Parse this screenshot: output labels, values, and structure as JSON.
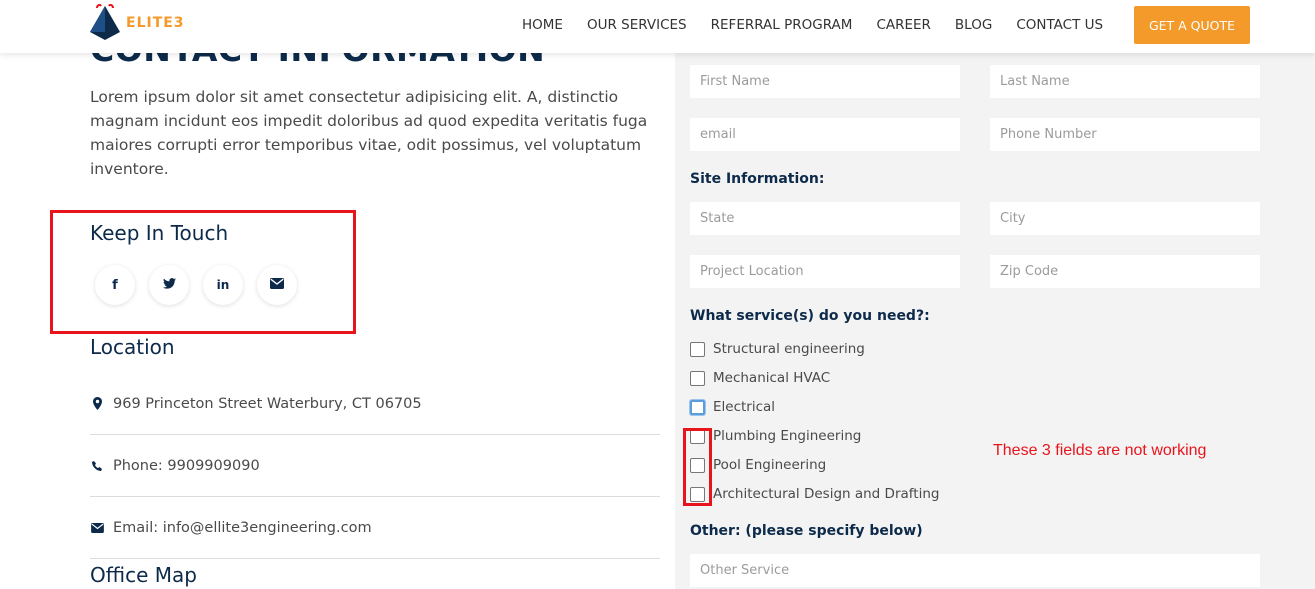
{
  "header": {
    "logo_text": "ELITE3",
    "nav": [
      "HOME",
      "OUR SERVICES",
      "REFERRAL PROGRAM",
      "CAREER",
      "BLOG",
      "CONTACT US"
    ],
    "cta": "GET A QUOTE"
  },
  "contact": {
    "heading": "CONTACT INFORMATION",
    "intro": "Lorem ipsum dolor sit amet consectetur adipisicing elit. A, distinctio magnam incidunt eos impedit doloribus ad quod expedita veritatis fuga maiores corrupti error temporibus vitae, odit possimus, vel voluptatum inventore.",
    "keep_in_touch": "Keep In Touch",
    "social": [
      "facebook-icon",
      "twitter-icon",
      "linkedin-icon",
      "email-icon"
    ],
    "location_title": "Location",
    "address": "969 Princeton Street Waterbury, CT 06705",
    "phone": "Phone: 9909909090",
    "email": "Email: info@ellite3engineering.com",
    "office_map_title": "Office Map"
  },
  "form": {
    "first_name": "First Name",
    "last_name": "Last Name",
    "email": "email",
    "phone": "Phone Number",
    "site_label": "Site Information:",
    "state": "State",
    "city": "City",
    "project_location": "Project Location",
    "zip": "Zip Code",
    "services_label": "What service(s) do you need?:",
    "services": [
      "Structural engineering",
      "Mechanical HVAC",
      "Electrical",
      "Plumbing Engineering",
      "Pool Engineering",
      "Architectural Design and Drafting"
    ],
    "other_label": "Other: (please specify below)",
    "other_placeholder": "Other Service"
  },
  "annotation": "These 3 fields are not working",
  "colors": {
    "accent": "#f39a2b",
    "navy": "#0d2a4a",
    "annotation_red": "#e8141c"
  }
}
